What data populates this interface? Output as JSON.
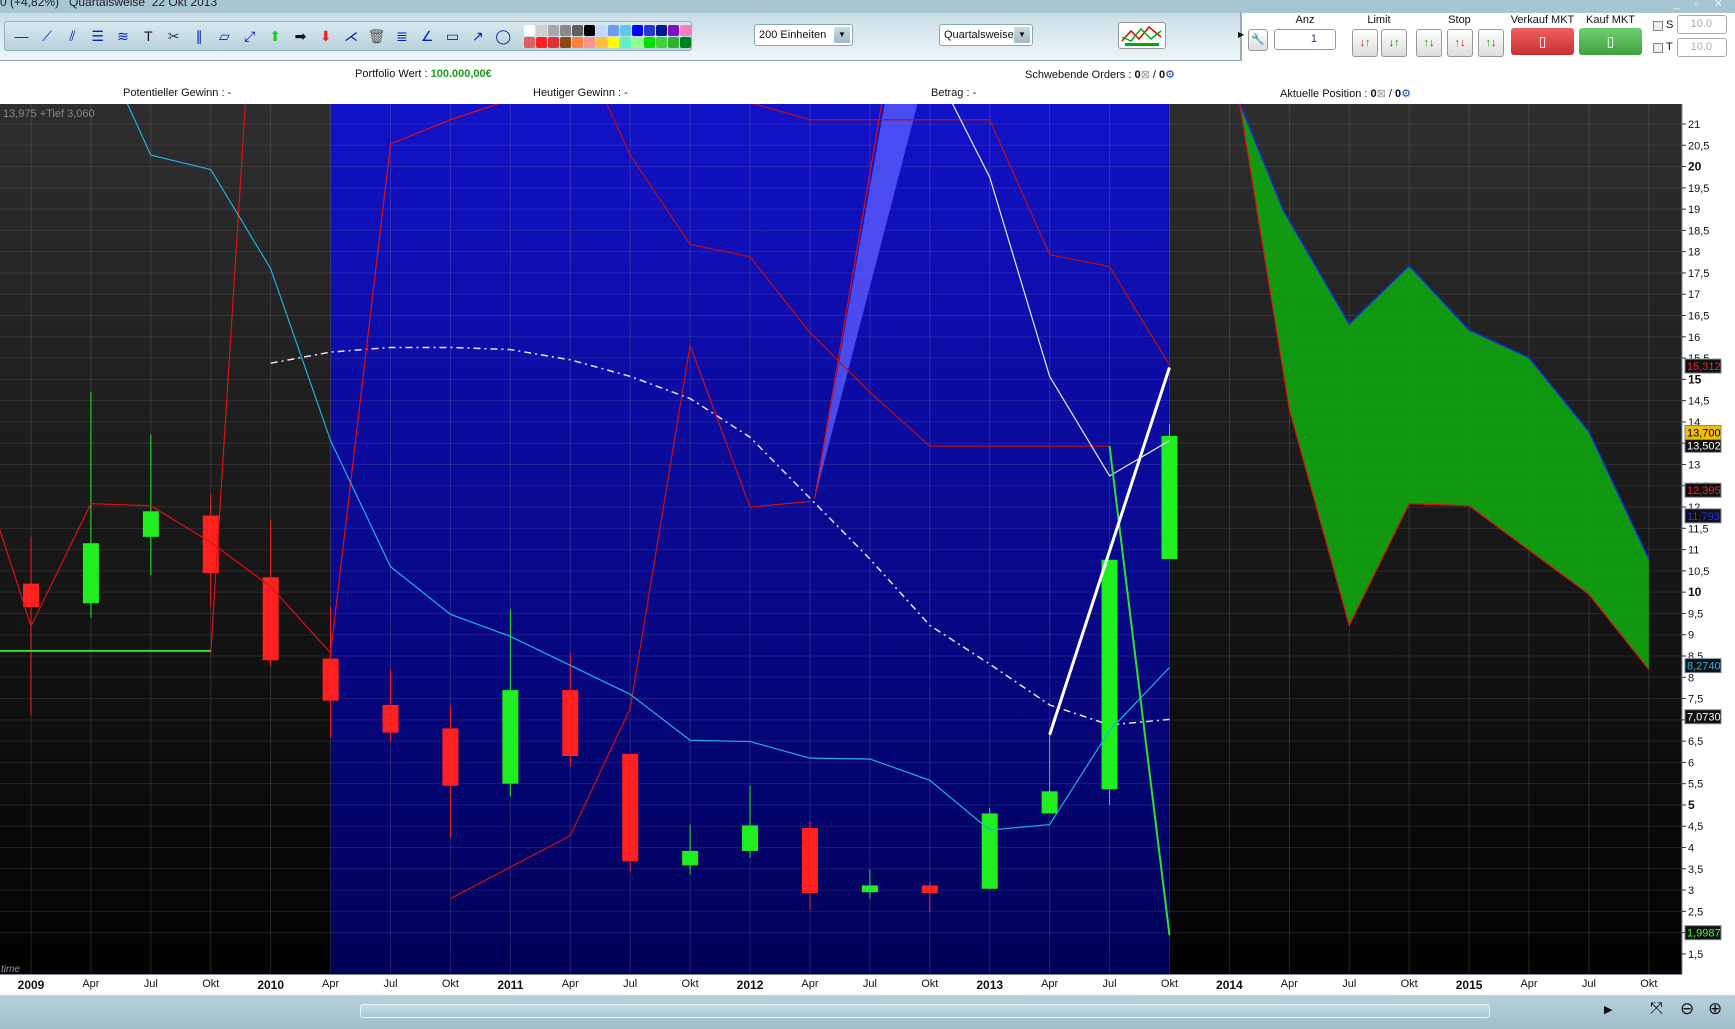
{
  "titlebar": {
    "text": "0 (+4,82%)   Quartalsweise  22 Okt 2013",
    "controls": "_ ▫ ✕"
  },
  "toolbar": {
    "tools": [
      "horizontal-line",
      "trend-line",
      "fan-lines",
      "fibonacci",
      "channel",
      "text",
      "settings",
      "parallel",
      "ruler",
      "points",
      "arrow-up",
      "arrow-right",
      "arrow-down",
      "pitchfork",
      "trash",
      "fib-extension",
      "angle",
      "rectangle",
      "ray",
      "ellipse"
    ],
    "palette": [
      "#ffffff",
      "#d0d0d0",
      "#a8a8a8",
      "#888888",
      "#606060",
      "#000000",
      "#c8d8ff",
      "#6f9cf0",
      "#5ac8f0",
      "#0000ff",
      "#2838c8",
      "#001890",
      "#8010c0",
      "#f080c0",
      "#e06060",
      "#ff2020",
      "#e03030",
      "#8a4a10",
      "#ff8040",
      "#ff9090",
      "#ffc040",
      "#ffff00",
      "#60f0c0",
      "#90ff90",
      "#00e000",
      "#40d040",
      "#30b030",
      "#008020"
    ],
    "units_select": "200 Einheiten",
    "period_select": "Quartalsweise"
  },
  "trade": {
    "anz_label": "Anz",
    "anz_value": "1",
    "limit_label": "Limit",
    "stop_label": "Stop",
    "sell_label": "Verkauf MKT",
    "buy_label": "Kauf MKT",
    "s_label": "S",
    "t_label": "T",
    "s_value": "10.0",
    "t_value": "10.0"
  },
  "info": {
    "portfolio_label": "Portfolio Wert : ",
    "portfolio_value": "100.000,00€",
    "pending_label": "Schwebende Orders : ",
    "pending_a": "0",
    "pending_sep": " / ",
    "pending_b": "0",
    "potential": "Potentieller Gewinn : -",
    "today": "Heutiger Gewinn : -",
    "betrag": "Betrag : -",
    "position_label": "Aktuelle Position : ",
    "position_a": "0",
    "position_sep": " / ",
    "position_b": "0"
  },
  "chart_data": {
    "type": "candlestick",
    "overlay_text": "13,975 +Tief 3,060",
    "time_label": "time",
    "ylim": [
      1.5,
      21
    ],
    "x_labels": [
      "2009",
      "Apr",
      "Jul",
      "Okt",
      "2010",
      "Apr",
      "Jul",
      "Okt",
      "2011",
      "Apr",
      "Jul",
      "Okt",
      "2012",
      "Apr",
      "Jul",
      "Okt",
      "2013",
      "Apr",
      "Jul",
      "Okt",
      "2014",
      "Apr",
      "Jul",
      "Okt",
      "2015",
      "Apr",
      "Jul",
      "Okt"
    ],
    "highlight_range": [
      5,
      19
    ],
    "candles": [
      [
        10.2,
        11.3,
        7.1,
        9.65
      ],
      [
        9.74,
        14.7,
        9.4,
        11.15
      ],
      [
        11.3,
        13.7,
        10.4,
        11.9
      ],
      [
        11.8,
        12.3,
        9.65,
        10.45
      ],
      [
        10.35,
        11.7,
        8.26,
        8.4
      ],
      [
        8.44,
        9.66,
        6.57,
        7.45
      ],
      [
        7.35,
        8.18,
        6.5,
        6.7
      ],
      [
        6.8,
        7.35,
        4.23,
        5.45
      ],
      [
        5.5,
        9.6,
        5.2,
        7.7
      ],
      [
        7.7,
        8.57,
        5.9,
        6.15
      ],
      [
        6.2,
        6.2,
        3.45,
        3.68
      ],
      [
        3.58,
        4.54,
        3.37,
        3.92
      ],
      [
        3.92,
        5.45,
        3.76,
        4.52
      ],
      [
        4.46,
        4.62,
        2.54,
        2.93
      ],
      [
        2.95,
        3.48,
        2.8,
        3.11
      ],
      [
        3.11,
        3.2,
        2.49,
        2.93
      ],
      [
        3.03,
        4.93,
        3.03,
        4.8
      ],
      [
        4.8,
        6.65,
        4.8,
        5.32
      ],
      [
        5.37,
        10.76,
        5.0,
        10.76
      ],
      [
        10.78,
        13.95,
        10.78,
        13.67
      ]
    ],
    "lines": [
      {
        "name": "red-line-1",
        "color": "#e01010",
        "w": 1.2,
        "points": [
          [
            -0.55,
            11.6
          ],
          [
            0,
            9.2
          ],
          [
            1,
            12.08
          ],
          [
            2,
            12.03
          ],
          [
            3,
            11.17
          ],
          [
            4,
            10.13
          ],
          [
            5,
            8.57
          ],
          [
            6,
            20.53
          ],
          [
            7,
            21.1
          ],
          [
            7.85,
            21.5
          ]
        ]
      },
      {
        "name": "red-line-2",
        "color": "#e01010",
        "w": 1.2,
        "points": [
          [
            3,
            8.57
          ],
          [
            3.58,
            21.5
          ]
        ]
      },
      {
        "name": "red-line-3",
        "color": "#d01010",
        "w": 1.2,
        "points": [
          [
            7,
            2.8
          ],
          [
            9,
            4.28
          ],
          [
            10,
            7.27
          ],
          [
            11,
            15.8
          ],
          [
            12,
            12.0
          ],
          [
            13,
            12.13
          ]
        ]
      },
      {
        "name": "red-line-4",
        "color": "#c01010",
        "w": 1.2,
        "points": [
          [
            9.6,
            21.5
          ],
          [
            10,
            20.27
          ],
          [
            11,
            18.17
          ],
          [
            12,
            17.88
          ],
          [
            13,
            16.1
          ],
          [
            14,
            14.7
          ],
          [
            15,
            13.43
          ],
          [
            18,
            13.43
          ]
        ]
      },
      {
        "name": "red-line-5",
        "color": "#c01010",
        "w": 1.2,
        "points": [
          [
            12,
            21.5
          ],
          [
            13,
            21.1
          ],
          [
            16,
            21.1
          ],
          [
            17,
            17.93
          ],
          [
            18,
            17.65
          ],
          [
            19,
            15.33
          ]
        ]
      },
      {
        "name": "red-line-6",
        "color": "#e01010",
        "w": 1.2,
        "points": [
          [
            13.08,
            12.2
          ],
          [
            14.2,
            21.5
          ]
        ]
      },
      {
        "name": "white-line",
        "color": "#e8e8e8",
        "w": 1.2,
        "points": [
          [
            15.37,
            21.5
          ],
          [
            16,
            19.75
          ],
          [
            17,
            15.07
          ],
          [
            18,
            12.73
          ],
          [
            19,
            13.56
          ]
        ]
      },
      {
        "name": "cyan-line",
        "color": "#20b0e0",
        "w": 1.2,
        "points": [
          [
            1.6,
            21.5
          ],
          [
            2,
            20.27
          ],
          [
            3,
            19.93
          ],
          [
            4,
            17.6
          ],
          [
            5,
            13.56
          ],
          [
            6,
            10.6
          ],
          [
            7,
            9.48
          ],
          [
            8,
            8.96
          ],
          [
            10,
            7.6
          ],
          [
            11,
            6.52
          ],
          [
            12,
            6.49
          ],
          [
            13,
            6.1
          ],
          [
            14,
            6.08
          ],
          [
            15,
            5.58
          ],
          [
            16,
            4.41
          ],
          [
            17,
            4.54
          ],
          [
            18,
            6.75
          ],
          [
            19,
            8.23
          ]
        ]
      },
      {
        "name": "green-horizontal",
        "color": "#30e030",
        "w": 2,
        "points": [
          [
            -0.6,
            8.62
          ],
          [
            3,
            8.62
          ]
        ]
      },
      {
        "name": "green-line",
        "color": "#30e030",
        "w": 2,
        "points": [
          [
            18,
            13.43
          ],
          [
            19,
            1.94
          ]
        ]
      },
      {
        "name": "white-trend",
        "color": "#ffffff",
        "w": 3,
        "points": [
          [
            17,
            6.65
          ],
          [
            19,
            15.28
          ]
        ]
      }
    ],
    "dashed_curve": [
      [
        4,
        15.38
      ],
      [
        5,
        15.64
      ],
      [
        6,
        15.75
      ],
      [
        7,
        15.75
      ],
      [
        8,
        15.7
      ],
      [
        9,
        15.46
      ],
      [
        10,
        15.07
      ],
      [
        11,
        14.55
      ],
      [
        12,
        13.64
      ],
      [
        13,
        12.21
      ],
      [
        14,
        10.78
      ],
      [
        15,
        9.22
      ],
      [
        16,
        8.31
      ],
      [
        17,
        7.35
      ],
      [
        18,
        6.88
      ],
      [
        19,
        7.01
      ]
    ],
    "cloud_top": [
      [
        20.17,
        21.5
      ],
      [
        20.9,
        18.97
      ],
      [
        22,
        16.3
      ],
      [
        23,
        17.67
      ],
      [
        24,
        16.16
      ],
      [
        25,
        15.51
      ],
      [
        26,
        13.77
      ],
      [
        27,
        10.78
      ]
    ],
    "cloud_bottom": [
      [
        20.17,
        21.5
      ],
      [
        21,
        14.3
      ],
      [
        22,
        9.22
      ],
      [
        23,
        12.08
      ],
      [
        24,
        12.03
      ],
      [
        25,
        10.99
      ],
      [
        26,
        9.95
      ],
      [
        27,
        8.18
      ]
    ],
    "price_tags": [
      {
        "text": "15,312",
        "value": 15.312,
        "color": "#ff2020",
        "bg": "#101010"
      },
      {
        "text": "13,502",
        "value": 13.45,
        "color": "#ffffff",
        "bg": "#101010"
      },
      {
        "text": "13,700",
        "value": 13.75,
        "color": "#000000",
        "bg": "#f0c000"
      },
      {
        "text": "12,395",
        "value": 12.395,
        "color": "#ff2020",
        "bg": "#101010"
      },
      {
        "text": "11,793",
        "value": 11.793,
        "color": "#2030ff",
        "bg": "#101010"
      },
      {
        "text": "8,2740",
        "value": 8.274,
        "color": "#20b8f0",
        "bg": "#101010"
      },
      {
        "text": "7,0730",
        "value": 7.073,
        "color": "#ffffff",
        "bg": "#101010"
      },
      {
        "text": "1,9987",
        "value": 1.9987,
        "color": "#30ff30",
        "bg": "#101010"
      }
    ]
  }
}
